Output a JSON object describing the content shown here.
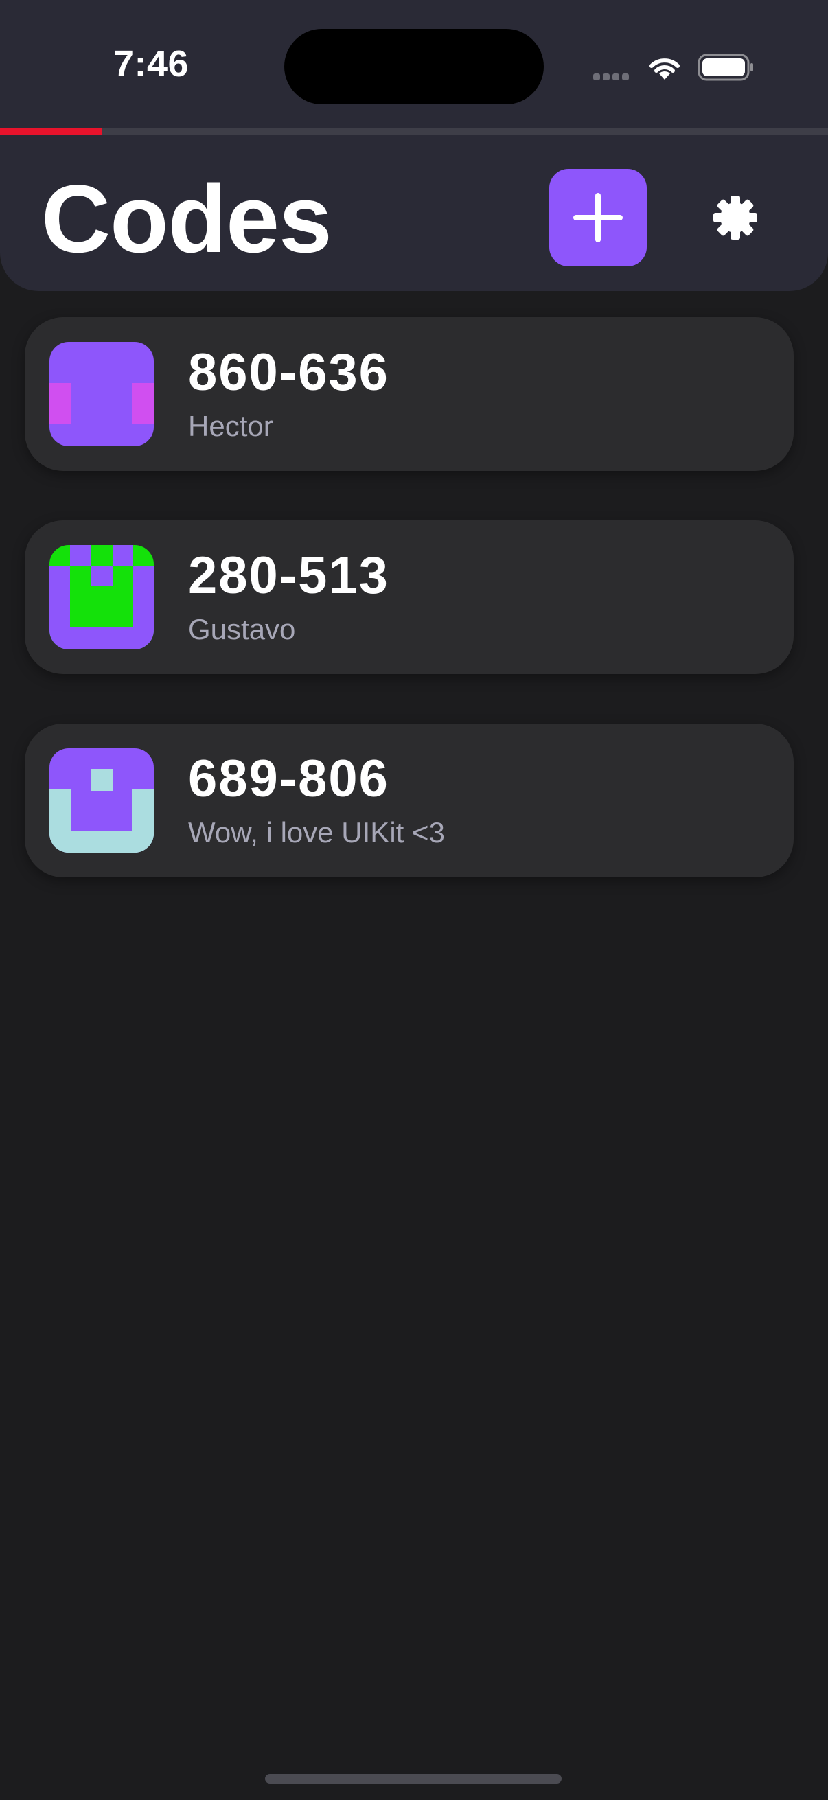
{
  "status_bar": {
    "time": "7:46",
    "icons": [
      "cellular-signal-icon",
      "wifi-icon",
      "battery-icon"
    ]
  },
  "refresh_progress": {
    "fraction": 0.123,
    "color": "#e8132c"
  },
  "header": {
    "title": "Codes",
    "add_icon": "plus-icon",
    "settings_icon": "gear-icon",
    "accent_color": "#8e56fb"
  },
  "codes": [
    {
      "code": "860-636",
      "name": "Hector",
      "avatar_icon": "identicon",
      "avatar_colors": [
        "#8e56fb",
        "#d04ff0"
      ]
    },
    {
      "code": "280-513",
      "name": "Gustavo",
      "avatar_icon": "identicon",
      "avatar_colors": [
        "#8e56fb",
        "#14e10a"
      ]
    },
    {
      "code": "689-806",
      "name": "Wow, i love UIKit <3",
      "avatar_icon": "identicon",
      "avatar_colors": [
        "#8e56fb",
        "#abdde0"
      ]
    }
  ]
}
